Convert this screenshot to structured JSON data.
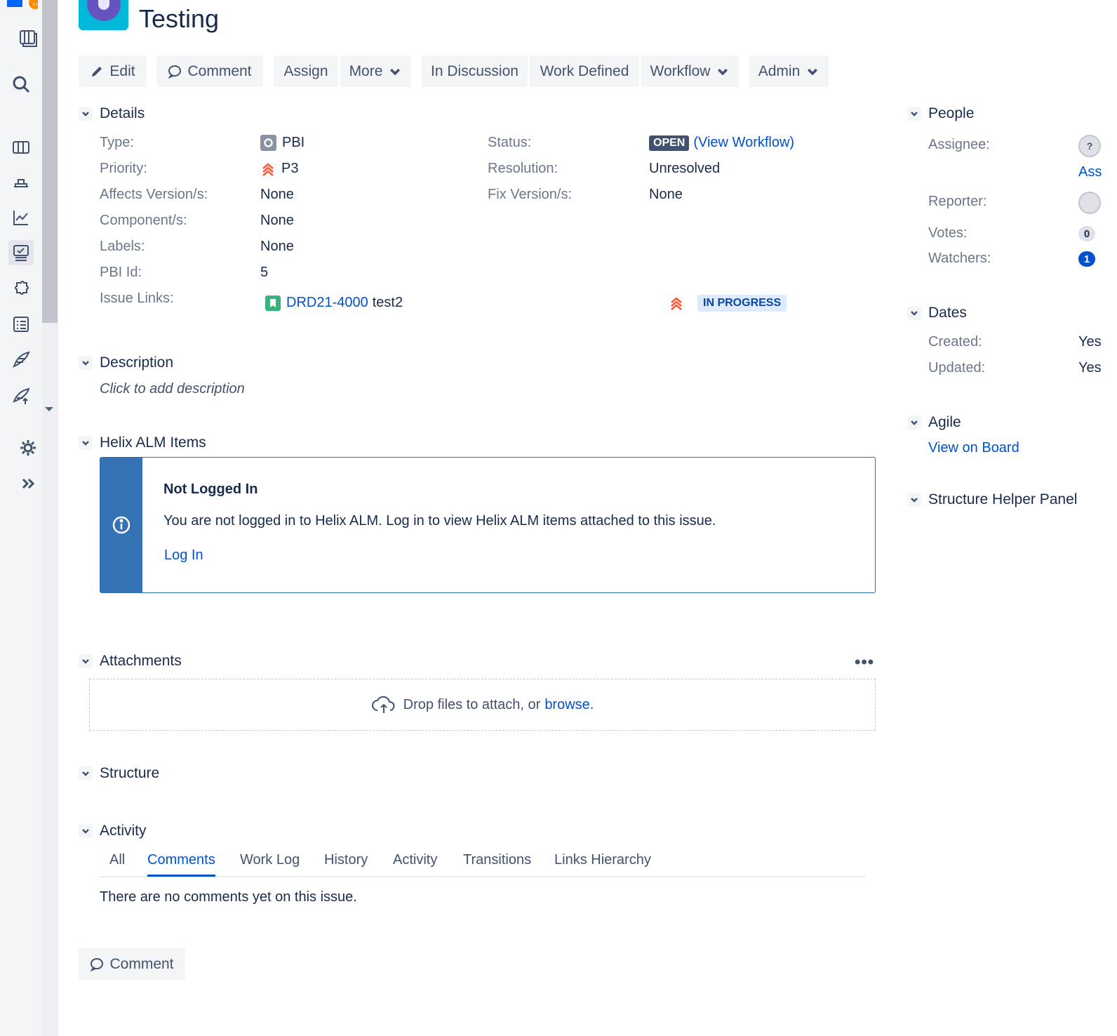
{
  "issue": {
    "title": "Testing"
  },
  "toolbar": {
    "edit": "Edit",
    "comment": "Comment",
    "assign": "Assign",
    "more": "More",
    "in_discussion": "In Discussion",
    "work_defined": "Work Defined",
    "workflow": "Workflow",
    "admin": "Admin"
  },
  "details": {
    "heading": "Details",
    "type_label": "Type:",
    "type_value": "PBI",
    "priority_label": "Priority:",
    "priority_value": "P3",
    "affects_label": "Affects Version/s:",
    "affects_value": "None",
    "component_label": "Component/s:",
    "component_value": "None",
    "labels_label": "Labels:",
    "labels_value": "None",
    "pbi_id_label": "PBI Id:",
    "pbi_id_value": "5",
    "issue_links_label": "Issue Links:",
    "link_key": "DRD21-4000",
    "link_summary": "test2",
    "link_status": "IN PROGRESS",
    "status_label": "Status:",
    "status_value": "OPEN",
    "view_workflow": "(View Workflow)",
    "resolution_label": "Resolution:",
    "resolution_value": "Unresolved",
    "fix_label": "Fix Version/s:",
    "fix_value": "None"
  },
  "description": {
    "heading": "Description",
    "placeholder": "Click to add description"
  },
  "helix": {
    "heading": "Helix ALM Items",
    "title": "Not Logged In",
    "message": "You are not logged in to Helix ALM. Log in to view Helix ALM items attached to this issue.",
    "login": "Log In"
  },
  "attachments": {
    "heading": "Attachments",
    "drop_text": "Drop files to attach, or",
    "browse": "browse.",
    "more": "•••"
  },
  "structure": {
    "heading": "Structure"
  },
  "activity": {
    "heading": "Activity",
    "tabs": [
      "All",
      "Comments",
      "Work Log",
      "History",
      "Activity",
      "Transitions",
      "Links Hierarchy"
    ],
    "active_tab": "Comments",
    "empty": "There are no comments yet on this issue.",
    "comment_button": "Comment"
  },
  "people": {
    "heading": "People",
    "assignee_label": "Assignee:",
    "assign_link": "Ass",
    "reporter_label": "Reporter:",
    "votes_label": "Votes:",
    "votes_value": "0",
    "watchers_label": "Watchers:",
    "watchers_value": "1"
  },
  "dates": {
    "heading": "Dates",
    "created_label": "Created:",
    "created_value": "Yes",
    "updated_label": "Updated:",
    "updated_value": "Yes"
  },
  "agile": {
    "heading": "Agile",
    "view_board": "View on Board"
  },
  "structure_helper": {
    "heading": "Structure Helper Panel"
  },
  "colors": {
    "link": "#0052cc",
    "text": "#172b4d",
    "muted": "#6b778c",
    "helix_bar": "#3573b5",
    "priority": "#ff5630"
  }
}
